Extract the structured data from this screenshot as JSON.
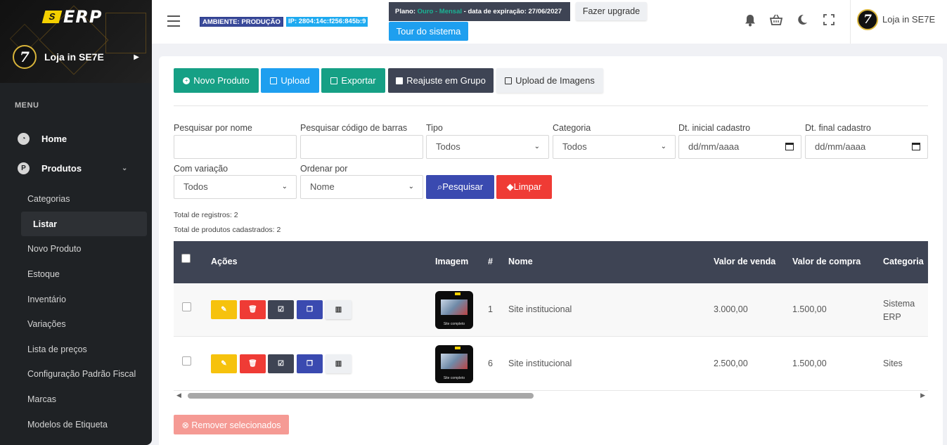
{
  "brand": {
    "logo_text": "ERP",
    "logo_mark": "S"
  },
  "store": {
    "name": "Loja in SE7E",
    "avatar_text": "7"
  },
  "sidebar": {
    "menu_label": "MENU",
    "home": {
      "label": "Home",
      "icon": "speedometer-icon"
    },
    "produtos": {
      "label": "Produtos",
      "icon": "p-circle-icon"
    },
    "sub_items": [
      "Categorias",
      "Listar",
      "Novo Produto",
      "Estoque",
      "Inventário",
      "Variações",
      "Lista de preços",
      "Configuração Padrão Fiscal",
      "Marcas",
      "Modelos de Etiqueta"
    ]
  },
  "header": {
    "env_badge": "AMBIENTE: PRODUÇÃO",
    "ip_badge": "IP: 2804:14c:f256:845b:9",
    "plan_prefix": "Plano:",
    "plan_name": "Ouro - Mensal",
    "plan_suffix": "- data de expiração: 27/06/2027",
    "upgrade_label": "Fazer upgrade",
    "tour_label": "Tour do sistema"
  },
  "toolbar": {
    "novo": "Novo Produto",
    "upload": "Upload",
    "exportar": "Exportar",
    "reajuste": "Reajuste em Grupo",
    "imagens": "Upload de Imagens"
  },
  "filters": {
    "nome_label": "Pesquisar por nome",
    "codigo_label": "Pesquisar código de barras",
    "tipo_label": "Tipo",
    "tipo_value": "Todos",
    "categoria_label": "Categoria",
    "categoria_value": "Todos",
    "dt_inicial_label": "Dt. inicial cadastro",
    "dt_final_label": "Dt. final cadastro",
    "date_placeholder": "dd/mm/aaaa",
    "variacao_label": "Com variação",
    "variacao_value": "Todos",
    "ordenar_label": "Ordenar por",
    "ordenar_value": "Nome",
    "pesquisar": "Pesquisar",
    "limpar": "Limpar"
  },
  "totals": {
    "registros": "Total de registros: 2",
    "produtos": "Total de produtos cadastrados: 2"
  },
  "table": {
    "headers": {
      "acoes": "Ações",
      "imagem": "Imagem",
      "num": "#",
      "nome": "Nome",
      "venda": "Valor de venda",
      "compra": "Valor de compra",
      "categoria": "Categoria"
    },
    "rows": [
      {
        "id": "1",
        "nome": "Site institucional",
        "venda": "3.000,00",
        "compra": "1.500,00",
        "categoria": "Sistema ERP",
        "thumb_caption": "Site completo"
      },
      {
        "id": "6",
        "nome": "Site institucional",
        "venda": "2.500,00",
        "compra": "1.500,00",
        "categoria": "Sites",
        "thumb_caption": "Site completo"
      }
    ]
  },
  "remover_label": "Remover selecionados",
  "colors": {
    "sidebar": "#1f2225",
    "teal": "#16a085",
    "blue": "#1e9fef",
    "dark": "#3e4454",
    "indigo": "#3a4ab0",
    "red": "#ef3b35",
    "yellow": "#f6c20d"
  }
}
